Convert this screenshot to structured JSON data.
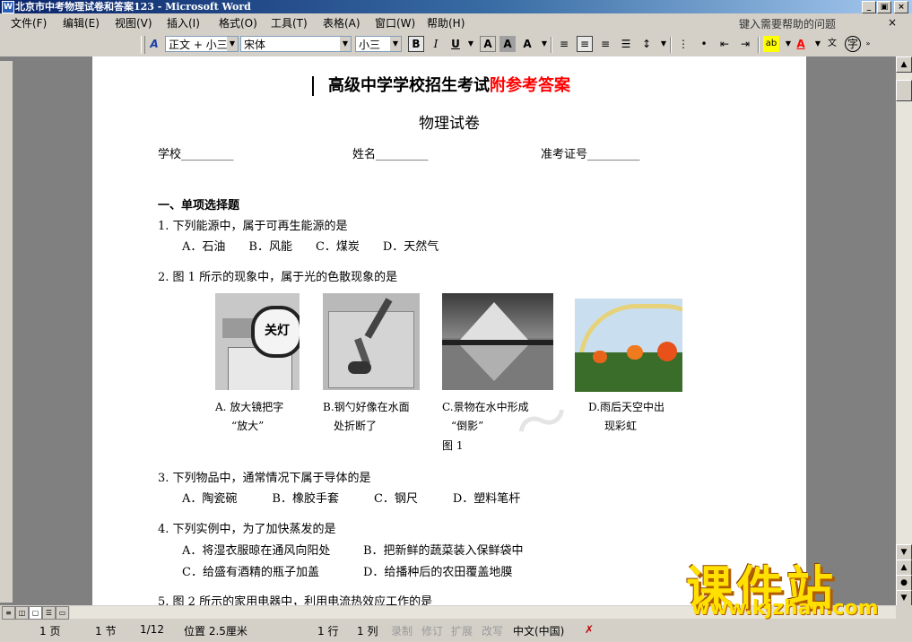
{
  "window": {
    "title": "北京市中考物理试卷和答案123 - Microsoft Word",
    "minimize": "_",
    "restore": "▣",
    "close": "×"
  },
  "menu": {
    "items": [
      "文件(F)",
      "编辑(E)",
      "视图(V)",
      "插入(I)",
      "格式(O)",
      "工具(T)",
      "表格(A)",
      "窗口(W)",
      "帮助(H)"
    ],
    "help_placeholder": "键入需要帮助的问题",
    "close": "×"
  },
  "toolbar": {
    "style": "正文 + 小三",
    "font": "宋体",
    "size": "小三"
  },
  "document": {
    "title_black": "高级中学学校招生考试",
    "title_red": "附参考答案",
    "title_red_color": "#ff0000",
    "subtitle": "物理试卷",
    "fields": {
      "school": "学校_________",
      "name": "姓名_________",
      "exam_no": "准考证号_________"
    },
    "section1": "一、单项选择题",
    "q1": {
      "stem": "1. 下列能源中，属于可再生能源的是",
      "options": "A．石油　　B．风能　　C．煤炭　　D．天然气"
    },
    "q2": {
      "stem": "2. 图 1 所示的现象中，属于光的色散现象的是",
      "captions": [
        {
          "l1": "A.  放大镜把字",
          "l2": "“放大”"
        },
        {
          "l1": "B.钢勺好像在水面",
          "l2": "处折断了"
        },
        {
          "l1": "C.景物在水中形成",
          "l2": "“倒影”"
        },
        {
          "l1": "D.雨后天空中出",
          "l2": "现彩虹"
        }
      ],
      "figure_label": "图 1",
      "magnifier_text": "关灯"
    },
    "q3": {
      "stem": "3. 下列物品中，通常情况下属于导体的是",
      "options": "A．陶瓷碗　　　B．橡胶手套　　　C．钢尺　　　D．塑料笔杆"
    },
    "q4": {
      "stem": "4. 下列实例中，为了加快蒸发的是",
      "opt_a": "A．将湿衣服晾在通风向阳处",
      "opt_b": "B．把新鲜的蔬菜装入保鲜袋中",
      "opt_c": "C．给盛有酒精的瓶子加盖",
      "opt_d": "D．给播种后的农田覆盖地膜"
    },
    "q5": {
      "stem": "5. 图 2 所示的家用电器中，利用电流热效应工作的是"
    }
  },
  "status": {
    "page": "1 页",
    "section": "1 节",
    "pages": "1/12",
    "position": "位置 2.5厘米",
    "line": "1 行",
    "col": "1 列",
    "rec": "录制",
    "trk": "修订",
    "ext": "扩展",
    "ovr": "改写",
    "lang": "中文(中国)"
  },
  "logo": {
    "text": "课件站",
    "url": "www.kjzhan.com"
  }
}
